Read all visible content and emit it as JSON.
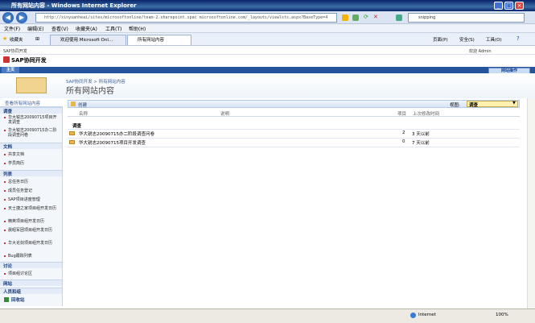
{
  "window": {
    "title": "所有网站内容 - Windows Internet Explorer"
  },
  "address": {
    "url": "http://xinyuanheai/sites/microsoftonline/team-2.sharepoint.spac microsoftonline.com/_layouts/viewlsts.aspx?BaseType=4",
    "search": "snipping"
  },
  "menu": [
    "文件(F)",
    "编辑(E)",
    "查看(V)",
    "收藏夹(A)",
    "工具(T)",
    "帮助(H)"
  ],
  "favorites": {
    "label": "收藏夹",
    "tabs": [
      "欢迎使用 Microsoft Onl...",
      "所有网站内容"
    ],
    "cmds": [
      "页面(P)",
      "安全(S)",
      "工具(O)"
    ]
  },
  "sp": {
    "top_left": "SAP协同开发",
    "welcome": "欢迎 Admin",
    "site": "SAP协同开发",
    "home_tab": "主页",
    "site_actions": "网站操作"
  },
  "header": {
    "breadcrumb": "SAP协同开发 > 所有网站内容",
    "title": "所有网站内容"
  },
  "left": {
    "all": "查看所有网站内容",
    "sections": [
      {
        "title": "调查",
        "items": [
          "华大锐志20090715项目开发调查",
          "华大锐志20090715办二阶段调查问卷"
        ]
      },
      {
        "title": "文档",
        "items": [
          "共享文档",
          "学员简历"
        ]
      },
      {
        "title": "列表",
        "items": [
          "总任务日历",
          "成员任务登记",
          "SAP项目进度管理",
          "天士捷之家项目组开发日历",
          "精英项目组开发日历",
          "晨昭军团项目组开发日历",
          "华大论剑项目组开发日历",
          "Bug跟踪列表"
        ]
      },
      {
        "title": "讨论",
        "items": [
          "项目组讨论区"
        ]
      },
      {
        "title": "网站",
        "items": []
      },
      {
        "title": "人员和组",
        "items": []
      }
    ],
    "recycle": "回收站"
  },
  "main": {
    "create": "创建",
    "view_label": "视图:",
    "view_value": "调查",
    "columns": {
      "name": "名称",
      "desc": "说明",
      "items": "项目",
      "modified": "上次修改时间"
    },
    "group": "调查",
    "rows": [
      {
        "name": "华大锐志20090715办二阶段调查问卷",
        "count": "2",
        "modified": "3 天以前"
      },
      {
        "name": "华大锐志20090715项目开发调查",
        "count": "0",
        "modified": "7 天以前"
      }
    ]
  },
  "status": {
    "zone": "Internet",
    "zoom": "100%"
  }
}
